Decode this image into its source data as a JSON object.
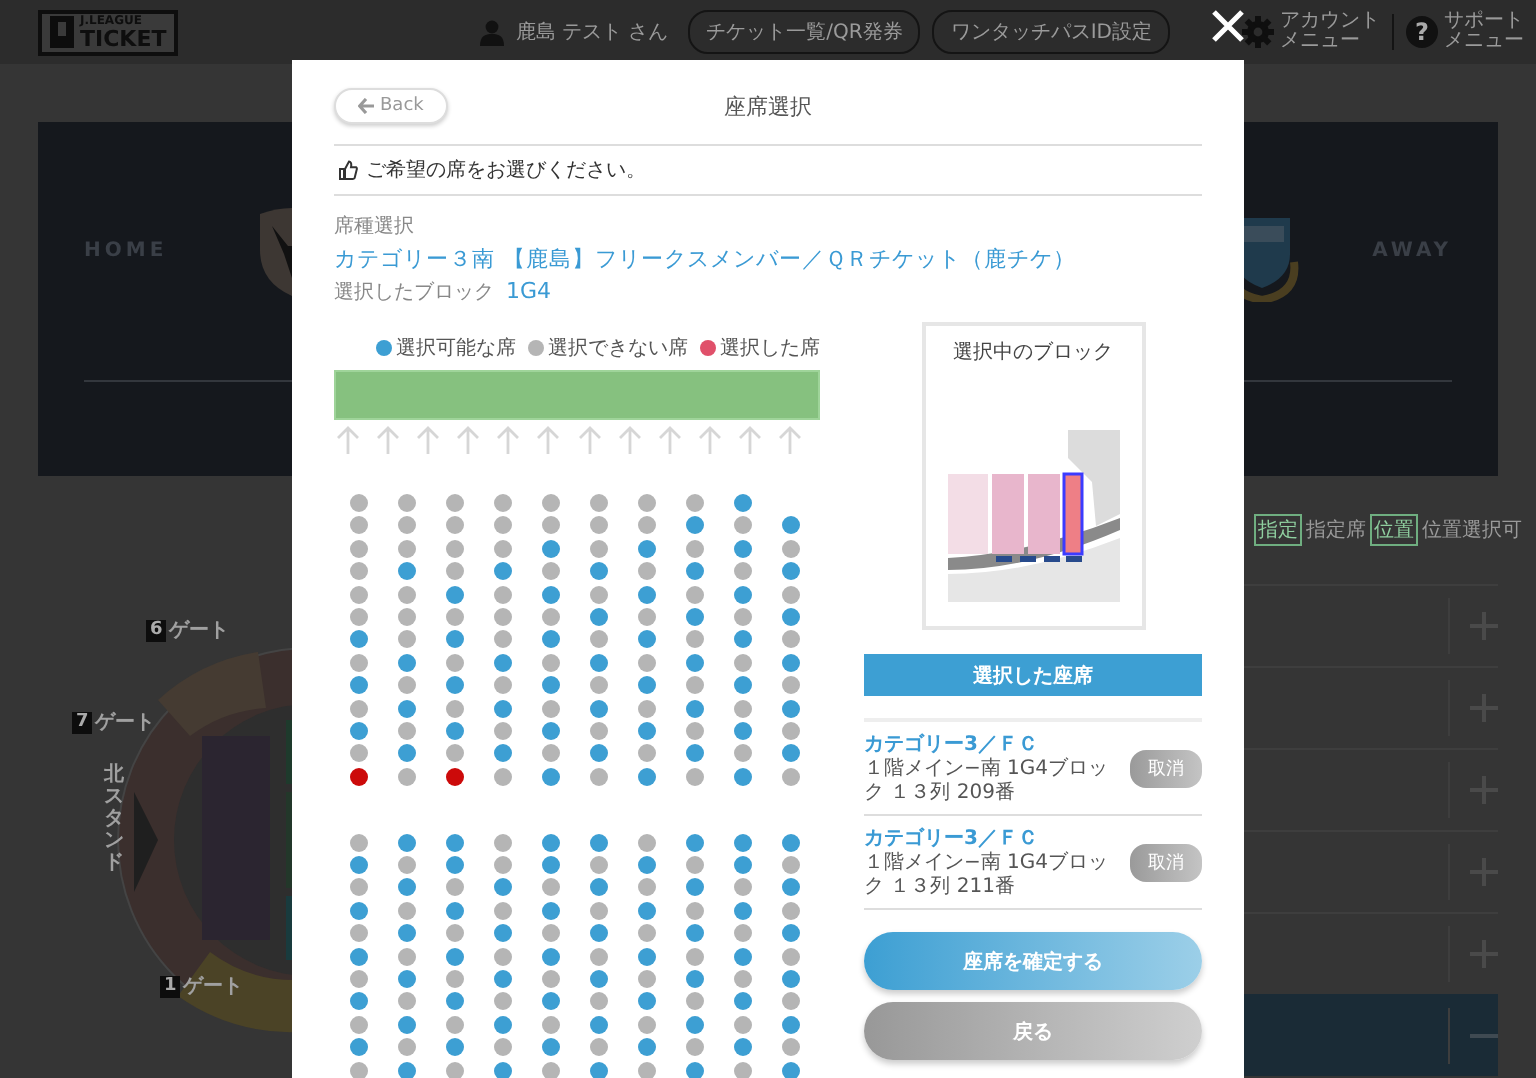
{
  "header": {
    "logo_lines": [
      "J.LEAGUE",
      "TICKET"
    ],
    "user": "鹿島 テスト さん",
    "buttons": [
      "チケット一覧/QR発券",
      "ワンタッチパスID設定"
    ],
    "menus": [
      {
        "kind": "account",
        "lines": [
          "アカウント",
          "メニュー"
        ]
      },
      {
        "kind": "support",
        "glyph": "?",
        "lines": [
          "サポート",
          "メニュー"
        ]
      }
    ]
  },
  "background": {
    "banner": {
      "home": "HOME",
      "away": "AWAY"
    },
    "legend": [
      {
        "kind": "tag",
        "text": "指定"
      },
      {
        "kind": "text",
        "text": "指定席"
      },
      {
        "kind": "tag",
        "text": "位置"
      },
      {
        "kind": "text",
        "text": "位置選択可"
      }
    ],
    "stadium": {
      "gates": [
        {
          "number": "6",
          "label": "ゲート"
        },
        {
          "number": "7",
          "label": "ゲート"
        },
        {
          "number": "1",
          "label": "ゲート"
        }
      ],
      "stand": "北スタンド"
    },
    "accordion": [
      {
        "expanded": false
      },
      {
        "expanded": false
      },
      {
        "expanded": false
      },
      {
        "expanded": false
      },
      {
        "expanded": false
      },
      {
        "expanded": true
      }
    ]
  },
  "dialog": {
    "back": "Back",
    "title": "座席選択",
    "notice": "ご希望の席をお選びください。",
    "seat_type_label": "席種選択",
    "seat_type": "カテゴリー３南 【鹿島】フリークスメンバー／ＱＲチケット（鹿チケ）",
    "block_label": "選択したブロック",
    "block": "1G4",
    "seat_legend": [
      {
        "label": "選択可能な席",
        "color": "#3d9fd3"
      },
      {
        "label": "選択できない席",
        "color": "#b5b5b5"
      },
      {
        "label": "選択した席",
        "color": "#e0506a"
      }
    ],
    "seat_blocks": [
      {
        "rows": [
          [
            {
              "kind": "unavailable"
            },
            {
              "kind": "unavailable"
            },
            {
              "kind": "unavailable"
            },
            {
              "kind": "unavailable"
            },
            {
              "kind": "unavailable"
            },
            {
              "kind": "unavailable"
            },
            {
              "kind": "unavailable"
            },
            {
              "kind": "unavailable"
            },
            {
              "kind": "available"
            },
            null
          ],
          [
            {
              "kind": "unavailable"
            },
            {
              "kind": "unavailable"
            },
            {
              "kind": "unavailable"
            },
            {
              "kind": "unavailable"
            },
            {
              "kind": "unavailable"
            },
            {
              "kind": "unavailable"
            },
            {
              "kind": "unavailable"
            },
            {
              "kind": "available"
            },
            {
              "kind": "unavailable"
            },
            {
              "kind": "available"
            }
          ],
          [
            {
              "kind": "unavailable"
            },
            {
              "kind": "unavailable"
            },
            {
              "kind": "unavailable"
            },
            {
              "kind": "unavailable"
            },
            {
              "kind": "available"
            },
            {
              "kind": "unavailable"
            },
            {
              "kind": "available"
            },
            {
              "kind": "unavailable"
            },
            {
              "kind": "available"
            },
            {
              "kind": "unavailable"
            }
          ],
          [
            {
              "kind": "unavailable"
            },
            {
              "kind": "available"
            },
            {
              "kind": "unavailable"
            },
            {
              "kind": "available"
            },
            {
              "kind": "unavailable"
            },
            {
              "kind": "available"
            },
            {
              "kind": "unavailable"
            },
            {
              "kind": "available"
            },
            {
              "kind": "unavailable"
            },
            {
              "kind": "available"
            }
          ],
          [
            {
              "kind": "unavailable"
            },
            {
              "kind": "unavailable"
            },
            {
              "kind": "available"
            },
            {
              "kind": "unavailable"
            },
            {
              "kind": "available"
            },
            {
              "kind": "unavailable"
            },
            {
              "kind": "available"
            },
            {
              "kind": "unavailable"
            },
            {
              "kind": "available"
            },
            {
              "kind": "unavailable"
            }
          ],
          [
            {
              "kind": "unavailable"
            },
            {
              "kind": "unavailable"
            },
            {
              "kind": "unavailable"
            },
            {
              "kind": "unavailable"
            },
            {
              "kind": "unavailable"
            },
            {
              "kind": "available"
            },
            {
              "kind": "unavailable"
            },
            {
              "kind": "available"
            },
            {
              "kind": "unavailable"
            },
            {
              "kind": "available"
            }
          ],
          [
            {
              "kind": "available"
            },
            {
              "kind": "unavailable"
            },
            {
              "kind": "available"
            },
            {
              "kind": "unavailable"
            },
            {
              "kind": "available"
            },
            {
              "kind": "unavailable"
            },
            {
              "kind": "available"
            },
            {
              "kind": "unavailable"
            },
            {
              "kind": "available"
            },
            {
              "kind": "unavailable"
            }
          ],
          [
            {
              "kind": "unavailable"
            },
            {
              "kind": "available"
            },
            {
              "kind": "unavailable"
            },
            {
              "kind": "available"
            },
            {
              "kind": "unavailable"
            },
            {
              "kind": "available"
            },
            {
              "kind": "unavailable"
            },
            {
              "kind": "available"
            },
            {
              "kind": "unavailable"
            },
            {
              "kind": "available"
            }
          ],
          [
            {
              "kind": "available"
            },
            {
              "kind": "unavailable"
            },
            {
              "kind": "available"
            },
            {
              "kind": "unavailable"
            },
            {
              "kind": "available"
            },
            {
              "kind": "unavailable"
            },
            {
              "kind": "available"
            },
            {
              "kind": "unavailable"
            },
            {
              "kind": "available"
            },
            {
              "kind": "unavailable"
            }
          ],
          [
            {
              "kind": "unavailable"
            },
            {
              "kind": "available"
            },
            {
              "kind": "unavailable"
            },
            {
              "kind": "available"
            },
            {
              "kind": "unavailable"
            },
            {
              "kind": "available"
            },
            {
              "kind": "unavailable"
            },
            {
              "kind": "available"
            },
            {
              "kind": "unavailable"
            },
            {
              "kind": "available"
            }
          ],
          [
            {
              "kind": "available"
            },
            {
              "kind": "unavailable"
            },
            {
              "kind": "available"
            },
            {
              "kind": "unavailable"
            },
            {
              "kind": "available"
            },
            {
              "kind": "unavailable"
            },
            {
              "kind": "available"
            },
            {
              "kind": "unavailable"
            },
            {
              "kind": "available"
            },
            {
              "kind": "unavailable"
            }
          ],
          [
            {
              "kind": "unavailable"
            },
            {
              "kind": "available"
            },
            {
              "kind": "unavailable"
            },
            {
              "kind": "available"
            },
            {
              "kind": "unavailable"
            },
            {
              "kind": "available"
            },
            {
              "kind": "unavailable"
            },
            {
              "kind": "available"
            },
            {
              "kind": "unavailable"
            },
            {
              "kind": "available"
            }
          ],
          [
            {
              "kind": "selected"
            },
            {
              "kind": "unavailable"
            },
            {
              "kind": "selected"
            },
            {
              "kind": "unavailable"
            },
            {
              "kind": "available"
            },
            {
              "kind": "unavailable"
            },
            {
              "kind": "available"
            },
            {
              "kind": "unavailable"
            },
            {
              "kind": "available"
            },
            {
              "kind": "unavailable"
            }
          ]
        ]
      },
      {
        "rows": [
          [
            {
              "kind": "unavailable"
            },
            {
              "kind": "available"
            },
            {
              "kind": "available"
            },
            {
              "kind": "unavailable"
            },
            {
              "kind": "available"
            },
            {
              "kind": "available"
            },
            {
              "kind": "unavailable"
            },
            {
              "kind": "available"
            },
            {
              "kind": "available"
            },
            {
              "kind": "available"
            }
          ],
          [
            {
              "kind": "available"
            },
            {
              "kind": "unavailable"
            },
            {
              "kind": "available"
            },
            {
              "kind": "unavailable"
            },
            {
              "kind": "available"
            },
            {
              "kind": "unavailable"
            },
            {
              "kind": "available"
            },
            {
              "kind": "unavailable"
            },
            {
              "kind": "available"
            },
            {
              "kind": "unavailable"
            }
          ],
          [
            {
              "kind": "unavailable"
            },
            {
              "kind": "available"
            },
            {
              "kind": "unavailable"
            },
            {
              "kind": "available"
            },
            {
              "kind": "unavailable"
            },
            {
              "kind": "available"
            },
            {
              "kind": "unavailable"
            },
            {
              "kind": "available"
            },
            {
              "kind": "unavailable"
            },
            {
              "kind": "available"
            }
          ],
          [
            {
              "kind": "available"
            },
            {
              "kind": "unavailable"
            },
            {
              "kind": "available"
            },
            {
              "kind": "unavailable"
            },
            {
              "kind": "available"
            },
            {
              "kind": "unavailable"
            },
            {
              "kind": "available"
            },
            {
              "kind": "unavailable"
            },
            {
              "kind": "available"
            },
            {
              "kind": "unavailable"
            }
          ],
          [
            {
              "kind": "unavailable"
            },
            {
              "kind": "available"
            },
            {
              "kind": "unavailable"
            },
            {
              "kind": "available"
            },
            {
              "kind": "unavailable"
            },
            {
              "kind": "available"
            },
            {
              "kind": "unavailable"
            },
            {
              "kind": "available"
            },
            {
              "kind": "unavailable"
            },
            {
              "kind": "available"
            }
          ],
          [
            {
              "kind": "available"
            },
            {
              "kind": "unavailable"
            },
            {
              "kind": "available"
            },
            {
              "kind": "unavailable"
            },
            {
              "kind": "available"
            },
            {
              "kind": "unavailable"
            },
            {
              "kind": "available"
            },
            {
              "kind": "unavailable"
            },
            {
              "kind": "available"
            },
            {
              "kind": "unavailable"
            }
          ],
          [
            {
              "kind": "unavailable"
            },
            {
              "kind": "available"
            },
            {
              "kind": "unavailable"
            },
            {
              "kind": "available"
            },
            {
              "kind": "unavailable"
            },
            {
              "kind": "available"
            },
            {
              "kind": "unavailable"
            },
            {
              "kind": "available"
            },
            {
              "kind": "unavailable"
            },
            {
              "kind": "available"
            }
          ],
          [
            {
              "kind": "available"
            },
            {
              "kind": "unavailable"
            },
            {
              "kind": "available"
            },
            {
              "kind": "unavailable"
            },
            {
              "kind": "available"
            },
            {
              "kind": "unavailable"
            },
            {
              "kind": "available"
            },
            {
              "kind": "unavailable"
            },
            {
              "kind": "available"
            },
            {
              "kind": "unavailable"
            }
          ],
          [
            {
              "kind": "unavailable"
            },
            {
              "kind": "available"
            },
            {
              "kind": "unavailable"
            },
            {
              "kind": "available"
            },
            {
              "kind": "unavailable"
            },
            {
              "kind": "available"
            },
            {
              "kind": "unavailable"
            },
            {
              "kind": "available"
            },
            {
              "kind": "unavailable"
            },
            {
              "kind": "available"
            }
          ],
          [
            {
              "kind": "available"
            },
            {
              "kind": "unavailable"
            },
            {
              "kind": "available"
            },
            {
              "kind": "unavailable"
            },
            {
              "kind": "available"
            },
            {
              "kind": "unavailable"
            },
            {
              "kind": "available"
            },
            {
              "kind": "unavailable"
            },
            {
              "kind": "available"
            },
            {
              "kind": "unavailable"
            }
          ],
          [
            {
              "kind": "unavailable"
            },
            {
              "kind": "available"
            },
            {
              "kind": "unavailable"
            },
            {
              "kind": "available"
            },
            {
              "kind": "unavailable"
            },
            {
              "kind": "available"
            },
            {
              "kind": "unavailable"
            },
            {
              "kind": "available"
            },
            {
              "kind": "unavailable"
            },
            {
              "kind": "available"
            }
          ]
        ]
      }
    ],
    "block_map_title": "選択中のブロック",
    "selected_header": "選択した座席",
    "selected_seats": [
      {
        "category": "カテゴリー3／ＦＣ",
        "seat": "１階メイン−南 1G4ブロック １３列 209番",
        "cancel": "取消"
      },
      {
        "category": "カテゴリー3／ＦＣ",
        "seat": "１階メイン−南 1G4ブロック １３列 211番",
        "cancel": "取消"
      }
    ],
    "confirm": "座席を確定する",
    "return": "戻る"
  }
}
